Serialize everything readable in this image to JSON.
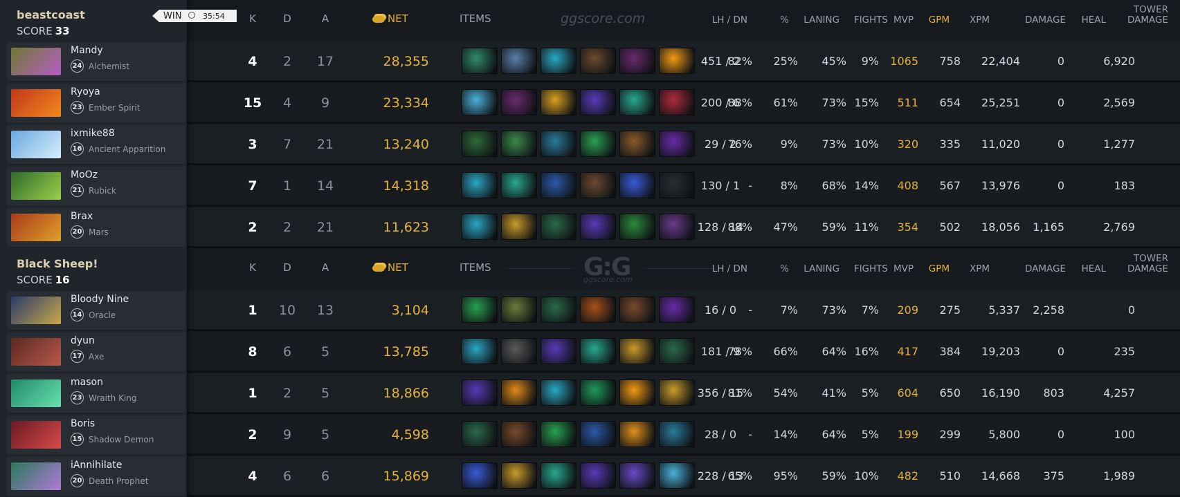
{
  "match": {
    "result": "WIN",
    "duration": "35:54"
  },
  "watermark": "ggscore.com",
  "logo": {
    "mark": "G:G",
    "sub": "ggscore.com"
  },
  "headers": {
    "k": "K",
    "d": "D",
    "a": "A",
    "net": "NET",
    "items": "ITEMS",
    "lhdn": "LH / DN",
    "pct": "%",
    "laning": "LANING",
    "fights": "FIGHTS",
    "mvp": "MVP",
    "gpm": "GPM",
    "xpm": "XPM",
    "damage": "DAMAGE",
    "heal": "HEAL",
    "tower1": "TOWER",
    "tower2": "DAMAGE"
  },
  "teams": [
    {
      "name": "beastcoast",
      "score_label": "SCORE",
      "score": "33",
      "players": [
        {
          "name": "Mandy",
          "level": "24",
          "hero": "Alchemist",
          "k": "4",
          "d": "2",
          "a": "17",
          "net": "28,355",
          "lhdn": "451 / 2",
          "pct": "82%",
          "laning": "25%",
          "fights": "45%",
          "mvp": "9%",
          "gpm": "1065",
          "xpm": "758",
          "damage": "22,404",
          "heal": "0",
          "tower": "6,920",
          "portrait": [
            "#6f7a2f",
            "#b65cc8"
          ],
          "items": [
            "#2f8a6a",
            "#5a7fa8",
            "#2aa7c2",
            "#6b4a2e",
            "#6a2a6e",
            "#f29a14"
          ]
        },
        {
          "name": "Ryoya",
          "level": "23",
          "hero": "Ember Spirit",
          "k": "15",
          "d": "4",
          "a": "9",
          "net": "23,334",
          "lhdn": "200 / 6",
          "pct": "88%",
          "laning": "61%",
          "fights": "73%",
          "mvp": "15%",
          "gpm": "511",
          "xpm": "654",
          "damage": "25,251",
          "heal": "0",
          "tower": "2,569",
          "portrait": [
            "#c4361a",
            "#f08a1e"
          ],
          "items": [
            "#4ab0d8",
            "#6a2a6e",
            "#d8a020",
            "#5a3ab8",
            "#28a88e",
            "#b02a3a"
          ]
        },
        {
          "name": "ixmike88",
          "level": "16",
          "hero": "Ancient Apparition",
          "k": "3",
          "d": "7",
          "a": "21",
          "net": "13,240",
          "lhdn": "29 / 2",
          "pct": "76%",
          "laning": "9%",
          "fights": "73%",
          "mvp": "10%",
          "gpm": "320",
          "xpm": "335",
          "damage": "11,020",
          "heal": "0",
          "tower": "1,277",
          "portrait": [
            "#6aa8e0",
            "#d6eefb"
          ],
          "items": [
            "#2e6a38",
            "#3a8a4a",
            "#2a7a9a",
            "#28a050",
            "#8a5a2a",
            "#6a2aa8"
          ]
        },
        {
          "name": "MoOz",
          "level": "21",
          "hero": "Rubick",
          "k": "7",
          "d": "1",
          "a": "14",
          "net": "14,318",
          "lhdn": "130 / 1",
          "pct": "-",
          "laning": "8%",
          "fights": "68%",
          "mvp": "14%",
          "gpm": "408",
          "xpm": "567",
          "damage": "13,976",
          "heal": "0",
          "tower": "183",
          "portrait": [
            "#2e6a2a",
            "#9ad04a"
          ],
          "items": [
            "#2aa7c2",
            "#28a88e",
            "#2a5aa8",
            "#6b4a2e",
            "#3a5ad8",
            "#2a2e33"
          ]
        },
        {
          "name": "Brax",
          "level": "20",
          "hero": "Mars",
          "k": "2",
          "d": "2",
          "a": "21",
          "net": "11,623",
          "lhdn": "128 / 14",
          "pct": "88%",
          "laning": "47%",
          "fights": "59%",
          "mvp": "11%",
          "gpm": "354",
          "xpm": "502",
          "damage": "18,056",
          "heal": "1,165",
          "tower": "2,769",
          "portrait": [
            "#a83a1a",
            "#e0a02a"
          ],
          "items": [
            "#2aa7c2",
            "#c89a2a",
            "#2a6a4a",
            "#5a3ab8",
            "#2a8a3a",
            "#6a3a8a"
          ]
        }
      ]
    },
    {
      "name": "Black Sheep!",
      "score_label": "SCORE",
      "score": "16",
      "players": [
        {
          "name": "Bloody Nine",
          "level": "14",
          "hero": "Oracle",
          "k": "1",
          "d": "10",
          "a": "13",
          "net": "3,104",
          "lhdn": "16 / 0",
          "pct": "-",
          "laning": "7%",
          "fights": "73%",
          "mvp": "7%",
          "gpm": "209",
          "xpm": "275",
          "damage": "5,337",
          "heal": "2,258",
          "tower": "0",
          "portrait": [
            "#2a3a6a",
            "#c8a84a"
          ],
          "items": [
            "#28a050",
            "#6a7a3a",
            "#2a6a4a",
            "#a8501a",
            "#7a4a2a",
            "#6a2aa8"
          ]
        },
        {
          "name": "dyun",
          "level": "17",
          "hero": "Axe",
          "k": "8",
          "d": "6",
          "a": "5",
          "net": "13,785",
          "lhdn": "181 / 9",
          "pct": "78%",
          "laning": "66%",
          "fights": "64%",
          "mvp": "16%",
          "gpm": "417",
          "xpm": "384",
          "damage": "19,203",
          "heal": "0",
          "tower": "235",
          "portrait": [
            "#5a2a22",
            "#b8584a"
          ],
          "items": [
            "#2aa7c2",
            "#5a5a5a",
            "#5a3ab8",
            "#28a88e",
            "#c89a2a",
            "#2a6a4a"
          ]
        },
        {
          "name": "mason",
          "level": "23",
          "hero": "Wraith King",
          "k": "1",
          "d": "2",
          "a": "5",
          "net": "18,866",
          "lhdn": "356 / 15",
          "pct": "81%",
          "laning": "54%",
          "fights": "41%",
          "mvp": "5%",
          "gpm": "604",
          "xpm": "650",
          "damage": "16,190",
          "heal": "803",
          "tower": "4,257",
          "portrait": [
            "#1e8a6a",
            "#6ae0b0"
          ],
          "items": [
            "#5a3ab8",
            "#e08a1a",
            "#2aa7c2",
            "#1e9a5a",
            "#f29a14",
            "#c89a2a"
          ]
        },
        {
          "name": "Boris",
          "level": "15",
          "hero": "Shadow Demon",
          "k": "2",
          "d": "9",
          "a": "5",
          "net": "4,598",
          "lhdn": "28 / 0",
          "pct": "-",
          "laning": "14%",
          "fights": "64%",
          "mvp": "5%",
          "gpm": "199",
          "xpm": "299",
          "damage": "5,800",
          "heal": "0",
          "tower": "100",
          "portrait": [
            "#6a1a22",
            "#d84a4a"
          ],
          "items": [
            "#2a6a4a",
            "#7a4a2a",
            "#28a050",
            "#2a5aa8",
            "#e0901a",
            "#2a7a9a"
          ]
        },
        {
          "name": "iAnnihilate",
          "level": "20",
          "hero": "Death Prophet",
          "k": "4",
          "d": "6",
          "a": "6",
          "net": "15,869",
          "lhdn": "228 / 13",
          "pct": "65%",
          "laning": "95%",
          "fights": "59%",
          "mvp": "10%",
          "gpm": "482",
          "xpm": "510",
          "damage": "14,668",
          "heal": "375",
          "tower": "1,989",
          "portrait": [
            "#2a7a5a",
            "#b07ad8"
          ],
          "items": [
            "#3a5ad8",
            "#c89a2a",
            "#28a88e",
            "#5a3ab8",
            "#6a4ac8",
            "#4ab0d8"
          ]
        }
      ]
    }
  ]
}
